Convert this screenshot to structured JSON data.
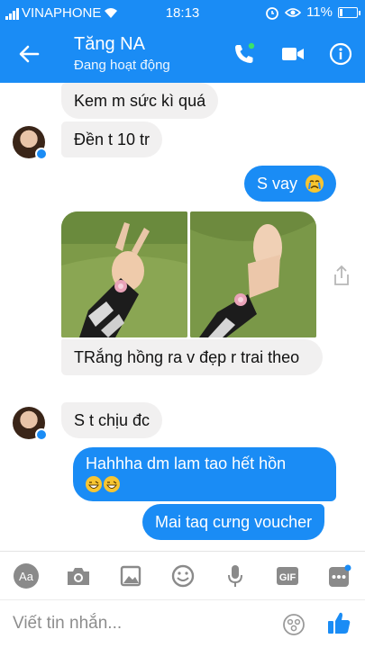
{
  "status_bar": {
    "carrier": "VINAPHONE",
    "time": "18:13",
    "battery": "11%"
  },
  "header": {
    "contact_name": "Tăng NA",
    "contact_status": "Đang hoạt động"
  },
  "messages": [
    {
      "direction": "in",
      "text": "Kem m sức kì quá"
    },
    {
      "direction": "in",
      "text": "Đền t 10 tr"
    },
    {
      "direction": "out",
      "text": "S vay",
      "emoji": "crying-face"
    },
    {
      "direction": "in",
      "type": "photos",
      "count": 2
    },
    {
      "direction": "in",
      "text": "TRắng hồng ra v đẹp r trai theo"
    },
    {
      "direction": "in",
      "text": "S t chịu đc"
    },
    {
      "direction": "out",
      "text": "Hahhha dm lam tao hết hồn",
      "emoji": "grinning-face-x2"
    },
    {
      "direction": "out",
      "text": "Mai taq cưng voucher"
    }
  ],
  "toolbar": {
    "items": [
      "Aa",
      "camera",
      "gallery",
      "emoji",
      "microphone",
      "GIF",
      "more"
    ]
  },
  "composer": {
    "placeholder": "Viết tin nhắn..."
  },
  "colors": {
    "accent": "#1a8cf5",
    "incoming": "#f1f0f0"
  }
}
